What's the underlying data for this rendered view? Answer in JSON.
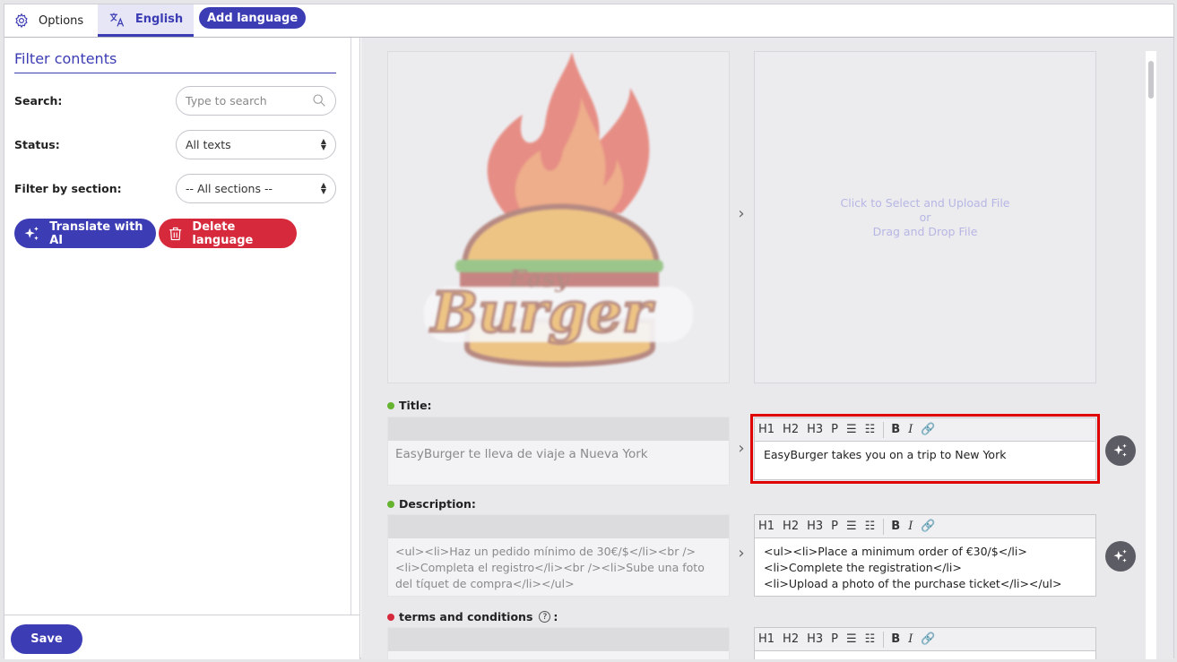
{
  "topbar": {
    "options_label": "Options",
    "english_label": "English",
    "add_language_label": "Add language"
  },
  "sidebar": {
    "title": "Filter contents",
    "search_label": "Search:",
    "search_placeholder": "Type to search",
    "status_label": "Status:",
    "status_value": "All texts",
    "section_label": "Filter by section:",
    "section_value": "-- All sections --",
    "translate_ai_label": "Translate with AI",
    "delete_language_label": "Delete language",
    "save_label": "Save"
  },
  "upload": {
    "line1": "Click to Select and Upload File",
    "line2": "or",
    "line3": "Drag and Drop File"
  },
  "logo": {
    "line1": "Easy",
    "line2": "Burger"
  },
  "toolbar": {
    "h1": "H1",
    "h2": "H2",
    "h3": "H3",
    "p": "P",
    "bold": "B",
    "italic": "I"
  },
  "fields": {
    "title": {
      "label": "Title:",
      "status_color": "#65b32e",
      "source": "EasyBurger te lleva de viaje a Nueva York",
      "translation": "EasyBurger takes you on a trip to New York"
    },
    "description": {
      "label": "Description:",
      "status_color": "#65b32e",
      "source_lines": [
        "<ul><li>Haz un pedido mínimo de 30€/$</li><br />",
        "<li>Completa el registro</li><br /><li>Sube una foto",
        "del tíquet de compra</li></ul>"
      ],
      "translation_lines": [
        "<ul><li>Place a minimum order of €30/$</li>",
        "<li>Complete the registration</li>",
        "<li>Upload a photo of the purchase ticket</li></ul>"
      ]
    },
    "terms": {
      "label": "terms and conditions",
      "colon": ":",
      "help": "?",
      "status_color": "#d62a3c"
    }
  },
  "colors": {
    "accent": "#3c3cb4",
    "danger": "#d62a3c",
    "highlight": "#e00000"
  }
}
